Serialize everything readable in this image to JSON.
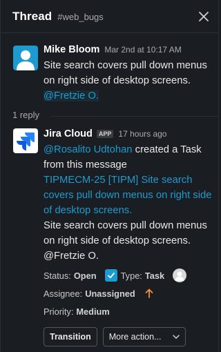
{
  "header": {
    "title": "Thread",
    "channel": "#web_bugs"
  },
  "parent_message": {
    "sender": "Mike Bloom",
    "timestamp": "Mar 2nd at 10:17 AM",
    "text": "Site search covers pull down menus on right side of desktop screens.",
    "mention": "@Fretzie O."
  },
  "replies": {
    "label": "1 reply"
  },
  "reply_message": {
    "sender": "Jira Cloud",
    "badge": "APP",
    "timestamp": "17 hours ago",
    "mention": "@Rosalito Udtohan",
    "action_text": "created a Task from this message",
    "issue_link": "TIPMECM-25 [TIPM] Site search covers pull down menus on right side of desktop screens.",
    "body": "Site search covers pull down menus on right side of desktop screens. @Fretzie O.",
    "fields": {
      "status_label": "Status:",
      "status_value": "Open",
      "type_label": "Type:",
      "type_value": "Task",
      "assignee_label": "Assignee:",
      "assignee_value": "Unassigned",
      "priority_label": "Priority:",
      "priority_value": "Medium"
    },
    "buttons": {
      "transition": "Transition",
      "more": "More action..."
    }
  },
  "colors": {
    "background": "#1a1d21",
    "link": "#1d9bd1",
    "priority_arrow": "#f79232",
    "jira_blue": "#2684ff"
  }
}
